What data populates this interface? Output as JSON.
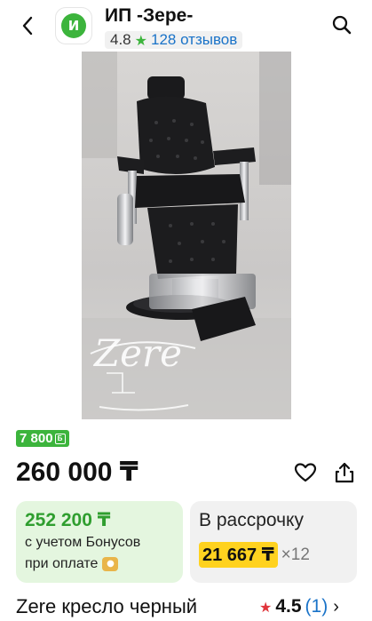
{
  "header": {
    "store_initial": "И",
    "store_name": "ИП -Зере-",
    "store_rating": "4.8",
    "store_reviews": "128 отзывов"
  },
  "image": {
    "watermark": "Zere"
  },
  "badge": {
    "bonus": "7 800"
  },
  "price": "260 000 ₸",
  "bonus_card": {
    "price": "252 200 ₸",
    "line1": "с учетом Бонусов",
    "line2": "при оплате"
  },
  "installment_card": {
    "title": "В рассрочку",
    "amount": "21 667 ₸",
    "multiplier": "×12"
  },
  "product": {
    "title": "Zere кресло черный",
    "rating": "4.5",
    "reviews_count": "(1)"
  },
  "colors": {
    "green": "#3cb43c",
    "link_blue": "#1a73c8",
    "yellow": "#ffd21f",
    "red_star": "#e0353b"
  }
}
